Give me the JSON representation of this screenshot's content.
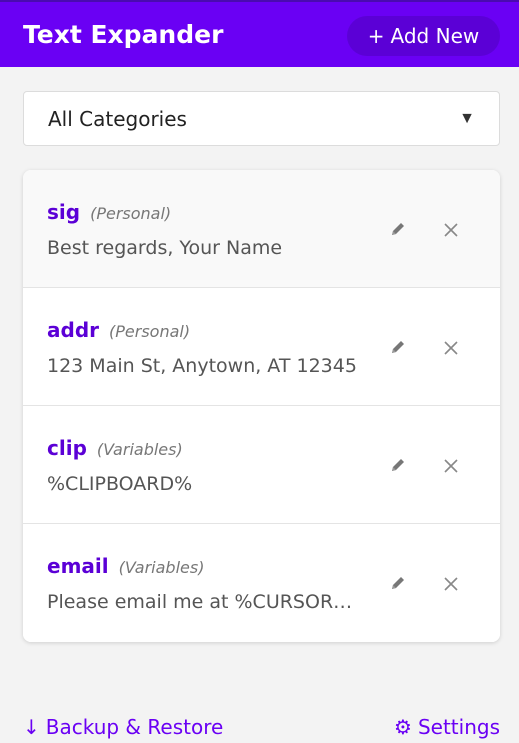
{
  "header": {
    "title": "Text Expander",
    "add_button_label": "Add New",
    "add_icon": "+"
  },
  "filter": {
    "selected": "All Categories",
    "arrow": "▼"
  },
  "snippets": [
    {
      "shortcut": "sig",
      "category": "(Personal)",
      "expansion": "Best regards, Your Name"
    },
    {
      "shortcut": "addr",
      "category": "(Personal)",
      "expansion": "123 Main St, Anytown, AT 12345"
    },
    {
      "shortcut": "clip",
      "category": "(Variables)",
      "expansion": "%CLIPBOARD%"
    },
    {
      "shortcut": "email",
      "category": "(Variables)",
      "expansion": "Please email me at %CURSOR%..."
    }
  ],
  "footer": {
    "backup_icon": "↓",
    "backup_label": "Backup & Restore",
    "settings_icon": "⚙",
    "settings_label": "Settings"
  },
  "colors": {
    "accent": "#6a00f4",
    "header_bg": "#6a00f4",
    "shortcut": "#5b00d6"
  }
}
